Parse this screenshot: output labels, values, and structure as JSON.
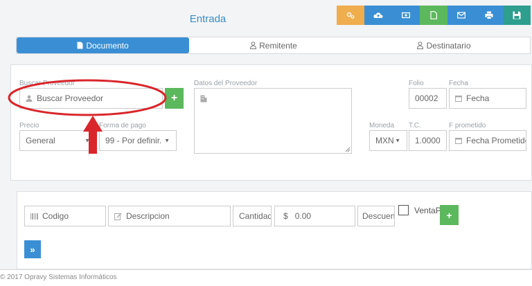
{
  "header": {
    "title": "Entrada"
  },
  "toolbar": {
    "buttons": [
      {
        "name": "settings",
        "color": "#f0ad4e"
      },
      {
        "name": "cloud-upload",
        "color": "#3a8fd4"
      },
      {
        "name": "cash",
        "color": "#3a8fd4"
      },
      {
        "name": "document",
        "color": "#5cb85c"
      },
      {
        "name": "email",
        "color": "#3a8fd4"
      },
      {
        "name": "print",
        "color": "#3a8fd4"
      },
      {
        "name": "save",
        "color": "#2e9e8f"
      }
    ]
  },
  "tabs": [
    {
      "label": "Documento",
      "active": true
    },
    {
      "label": "Remitente",
      "active": false
    },
    {
      "label": "Destinatario",
      "active": false
    }
  ],
  "form": {
    "buscar_label": "Buscar Proveedor",
    "buscar_placeholder": "Buscar Proveedor",
    "datos_label": "Datos del Proveedor",
    "folio_label": "Folio",
    "folio_value": "00002",
    "fecha_label": "Fecha",
    "fecha_placeholder": "Fecha",
    "precio_label": "Precio",
    "precio_value": "General",
    "forma_label": "Forma de pago",
    "forma_value": "99 - Por definir.",
    "moneda_label": "Moneda",
    "moneda_value": "MXN",
    "tc_label": "T.C.",
    "tc_value": "1.0000",
    "fprometido_label": "F prometido",
    "fprometido_placeholder": "Fecha Prometido"
  },
  "items": {
    "codigo_placeholder": "Codigo",
    "descripcion_placeholder": "Descripcion",
    "cantidad_placeholder": "Cantidad",
    "precio_prefix": "$",
    "precio_value": "0.00",
    "descuento_placeholder": "Descuento",
    "venta_label": "VentaPorKg"
  },
  "footer": {
    "text": "© 2017 Opravy Sistemas Informáticos"
  },
  "annotation": {
    "color": "#d9262b"
  }
}
